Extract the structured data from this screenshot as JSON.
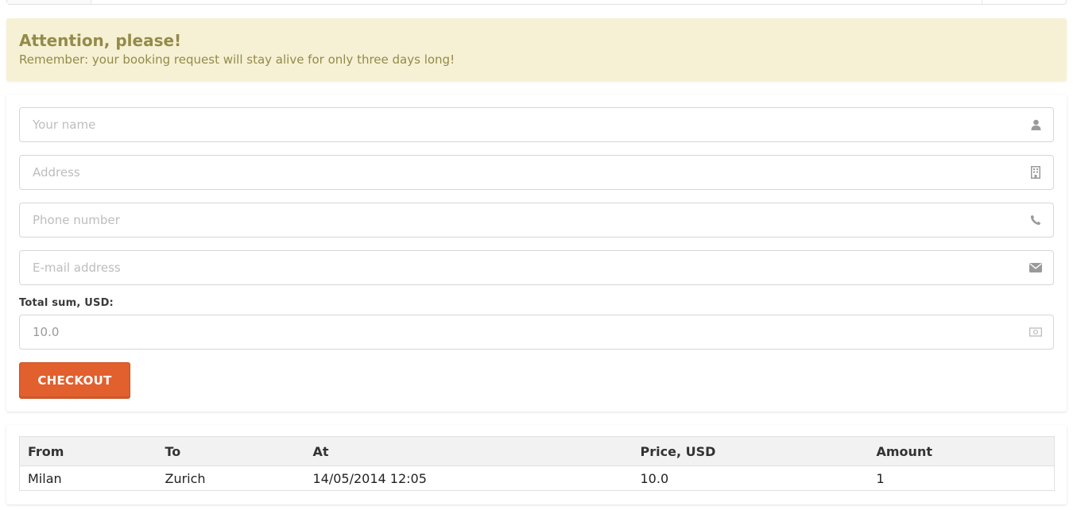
{
  "alert": {
    "title": "Attention, please!",
    "text": "Remember: your booking request will stay alive for only three days long!"
  },
  "form": {
    "name_placeholder": "Your name",
    "address_placeholder": "Address",
    "phone_placeholder": "Phone number",
    "email_placeholder": "E-mail address",
    "total_label": "Total sum, USD:",
    "total_value": "10.0",
    "checkout_label": "CHECKOUT",
    "icons": {
      "name": "user-icon",
      "address": "building-icon",
      "phone": "phone-icon",
      "email": "envelope-icon",
      "total": "money-icon"
    }
  },
  "table": {
    "headers": [
      "From",
      "To",
      "At",
      "Price, USD",
      "Amount"
    ],
    "rows": [
      [
        "Milan",
        "Zurich",
        "14/05/2014 12:05",
        "10.0",
        "1"
      ]
    ]
  },
  "colors": {
    "alert_bg": "#f6f1d4",
    "alert_text": "#948a4a",
    "checkout_bg": "#e25f2e"
  }
}
